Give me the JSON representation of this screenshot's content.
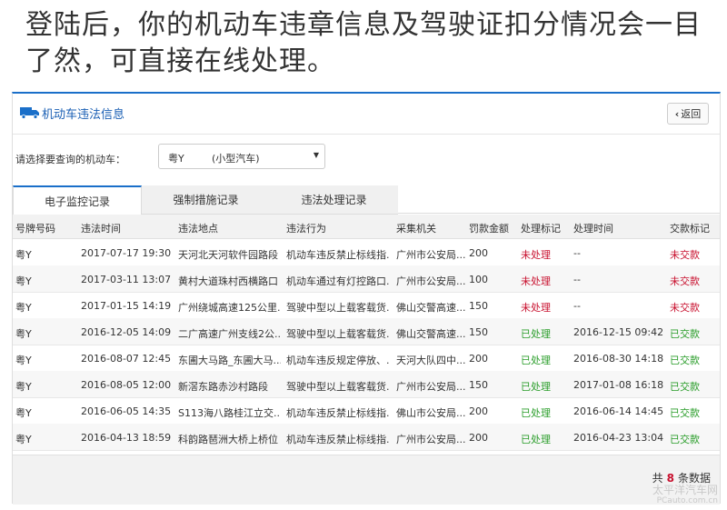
{
  "caption": "登陆后，你的机动车违章信息及驾驶证扣分情况会一目了然，可直接在线处理。",
  "panel": {
    "title": "机动车违法信息",
    "back_label": "返回",
    "select_label": "请选择要查询的机动车：",
    "selected_plate": "粤Y",
    "selected_type": "(小型汽车)"
  },
  "tabs": [
    "电子监控记录",
    "强制措施记录",
    "违法处理记录"
  ],
  "table": {
    "headers": [
      "号牌号码",
      "违法时间",
      "违法地点",
      "违法行为",
      "采集机关",
      "罚款金额",
      "处理标记",
      "处理时间",
      "交款标记"
    ],
    "rows": [
      [
        "粤Y",
        "2017-07-17 19:30",
        "天河北天河软件园路段",
        "机动车违反禁止标线指...",
        "广州市公安局...",
        "200",
        "未处理",
        "--",
        "未交款"
      ],
      [
        "粤Y",
        "2017-03-11 13:07",
        "黄村大道珠村西横路口",
        "机动车通过有灯控路口...",
        "广州市公安局...",
        "100",
        "未处理",
        "--",
        "未交款"
      ],
      [
        "粤Y",
        "2017-01-15 14:19",
        "广州绕城高速125公里...",
        "驾驶中型以上载客载货...",
        "佛山交警高速...",
        "150",
        "未处理",
        "--",
        "未交款"
      ],
      [
        "粤Y",
        "2016-12-05 14:09",
        "二广高速广州支线2公...",
        "驾驶中型以上载客载货...",
        "佛山交警高速...",
        "150",
        "已处理",
        "2016-12-15 09:42",
        "已交款"
      ],
      [
        "粤Y",
        "2016-08-07 12:45",
        "东圃大马路_东圃大马...",
        "机动车违反规定停放、...",
        "天河大队四中...",
        "200",
        "已处理",
        "2016-08-30 14:18",
        "已交款"
      ],
      [
        "粤Y",
        "2016-08-05 12:00",
        "新滘东路赤沙村路段",
        "驾驶中型以上载客载货...",
        "广州市公安局...",
        "150",
        "已处理",
        "2017-01-08 16:18",
        "已交款"
      ],
      [
        "粤Y",
        "2016-06-05 14:35",
        "S113海八路桂江立交...",
        "机动车违反禁止标线指...",
        "佛山市公安局...",
        "200",
        "已处理",
        "2016-06-14 14:45",
        "已交款"
      ],
      [
        "粤Y",
        "2016-04-13 18:59",
        "科韵路琶洲大桥上桥位",
        "机动车违反禁止标线指...",
        "广州市公安局...",
        "200",
        "已处理",
        "2016-04-23 13:04",
        "已交款"
      ]
    ]
  },
  "footer": {
    "prefix": "共",
    "count": "8",
    "suffix": "条数据"
  },
  "watermark": {
    "line1": "太平洋汽车网",
    "line2": "PCauto.com.cn"
  },
  "colors": {
    "accent": "#1a6fc9",
    "unprocessed": "#c8102e",
    "processed": "#2a9d2a"
  }
}
